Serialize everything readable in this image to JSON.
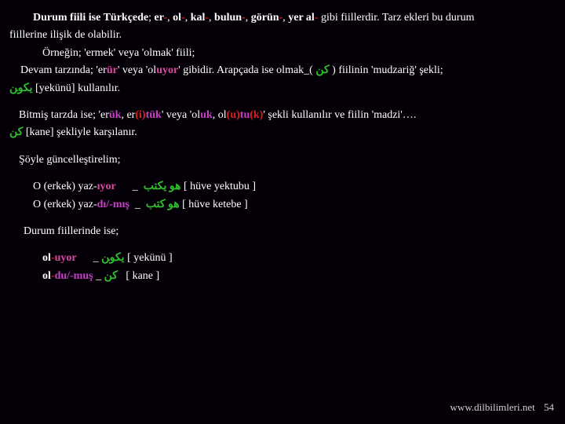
{
  "p1": {
    "lead": "Durum fiili ise Türkçede",
    "sep": "; ",
    "er": "er",
    "ol": "ol",
    "kal": "kal",
    "bulun": "bulun",
    "gorun": "görün",
    "yeral": "yer al",
    "dash": "-",
    "comma": ", ",
    "tail": " gibi fiillerdir. Tarz ekleri bu durum"
  },
  "p1b": "fiillerine ilişik de olabilir.",
  "p2": "Örneğin; 'ermek' veya 'olmak' fiili;",
  "p3": {
    "a": "Devam tarzında; 'er",
    "ur": "ür",
    "b": "' veya 'ol",
    "uyor": "uyor",
    "c": "' gibidir. Arapçada ise olmak_( ",
    "kn": "ﻛﻦ",
    "d": " ) fiilinin 'mudzariğ' şekli;"
  },
  "p4": {
    "yek": "ﻳﻜﻮﻦ",
    "t": " [yekünü] kullanılır."
  },
  "p5": {
    "a": "Bitmiş tarzda ise; 'er",
    "uk": "ük",
    "b": ", er",
    "i": "(i)",
    "tuk": "tük",
    "c": "' veya 'ol",
    "uk2": "uk",
    "d": ", ol",
    "u": "(u)",
    "tu": "tu",
    "k": "(k)",
    "e": "' şekli kullanılır ve fiilin 'madzi'…."
  },
  "p6": {
    "kn": "ﻛﻦ",
    "t": " [kane] şekliyle karşılanır."
  },
  "p7": "Şöyle güncelleştirelim;",
  "ex1": {
    "a": "O (erkek) yaz-",
    "iyor": "ıyor",
    "mid": "      _  ",
    "ar": "ﻫﻮ ﻳﻜﺘﺐ",
    "t": " [ hüve yektubu ]"
  },
  "ex2": {
    "a": "O (erkek) yaz-",
    "dimis": "dı/-mış",
    "mid": "  _  ",
    "ar": "ﻫﻮ ﻛﺘﺐ",
    "t": " [ hüve ketebe ]"
  },
  "p8": "Durum fiillerinde ise;",
  "ex3": {
    "ol": "ol",
    "dash": "-",
    "uyor": "uyor",
    "mid": "      _ ",
    "ar": "ﻳﻜﻮﻦ",
    "t": " [ yekünü ]"
  },
  "ex4": {
    "ol": "ol",
    "dash": "-",
    "dumus": "du/-muş",
    "mid": " _ ",
    "ar": "ﻛﻦ",
    "t": "   [ kane ]"
  },
  "footer": {
    "site": "www.dilbilimleri.net",
    "page": "54"
  }
}
